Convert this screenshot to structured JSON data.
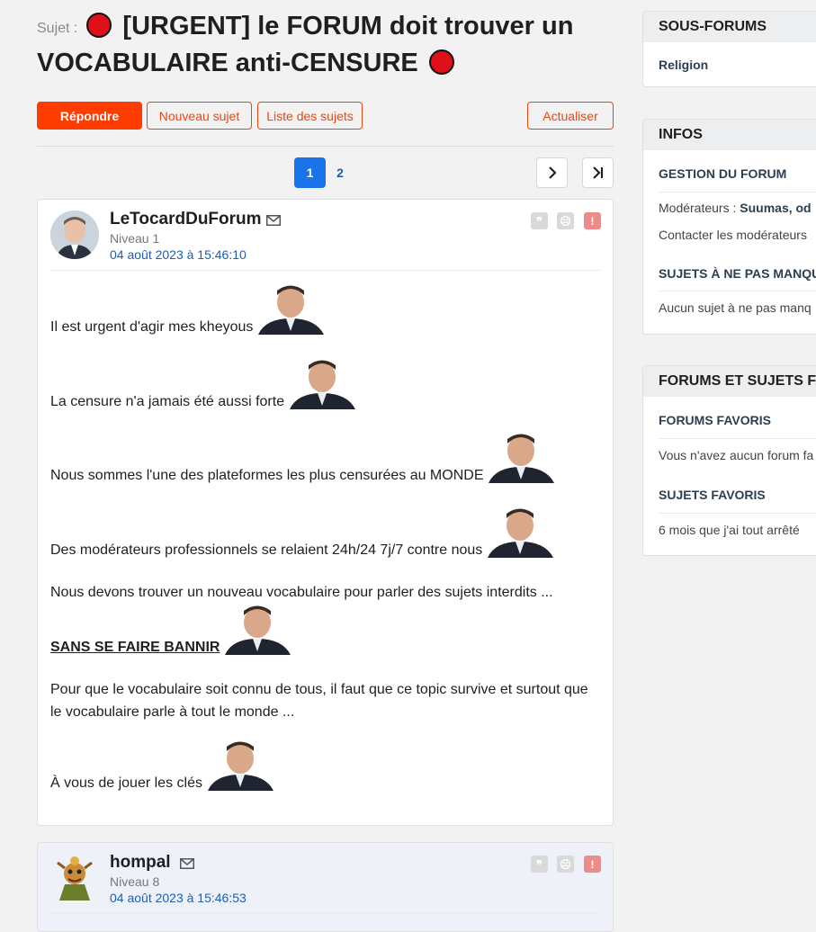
{
  "topic": {
    "prefix": "Sujet :",
    "title_part1": "[URGENT] le FORUM doit trouver un",
    "title_part2": "VOCABULAIRE anti-CENSURE"
  },
  "toolbar": {
    "reply": "Répondre",
    "new_topic": "Nouveau sujet",
    "topic_list": "Liste des sujets",
    "refresh": "Actualiser"
  },
  "pagination": {
    "current": "1",
    "next_page": "2",
    "next_icon": "chevron-right",
    "last_icon": "skip-to-last"
  },
  "posts": [
    {
      "author": "LeTocardDuForum",
      "level": "Niveau 1",
      "date": "04 août 2023 à 15:46:10",
      "lines": [
        "Il est urgent d'agir mes kheyous",
        "La censure n'a jamais été aussi forte",
        "Nous sommes l'une des plateformes les plus censurées au MONDE",
        "Des modérateurs professionnels se relaient 24h/24 7j/7 contre nous",
        "Nous devons trouver un nouveau vocabulaire pour parler des sujets interdits ...",
        "SANS SE FAIRE BANNIR",
        "Pour que le vocabulaire soit connu de tous, il faut que ce topic survive et surtout que le vocabulaire parle à tout le monde ...",
        "À vous de jouer les clés"
      ]
    },
    {
      "author": "hompal",
      "level": "Niveau 8",
      "date": "04 août 2023 à 15:46:53"
    }
  ],
  "sidebar": {
    "subforums": {
      "title": "SOUS-FORUMS",
      "items": [
        "Religion"
      ]
    },
    "infos": {
      "title": "INFOS",
      "management": "GESTION DU FORUM",
      "moderators_label": "Modérateurs :",
      "moderators_value": "Suumas, od",
      "contact": "Contacter les modérateurs",
      "must_see_title": "SUJETS À NE PAS MANQU",
      "must_see_empty": "Aucun sujet à ne pas manq"
    },
    "favorites": {
      "title": "FORUMS ET SUJETS FA",
      "fav_forums_title": "FORUMS FAVORIS",
      "fav_forums_empty": "Vous n'avez aucun forum fa",
      "fav_topics_title": "SUJETS FAVORIS",
      "fav_topics_item": "6 mois que j'ai tout arrêté"
    }
  },
  "colors": {
    "accent": "#ff3c00",
    "link": "#1a5fb4",
    "page_active": "#1a73e8",
    "report": "#e86a6a"
  }
}
